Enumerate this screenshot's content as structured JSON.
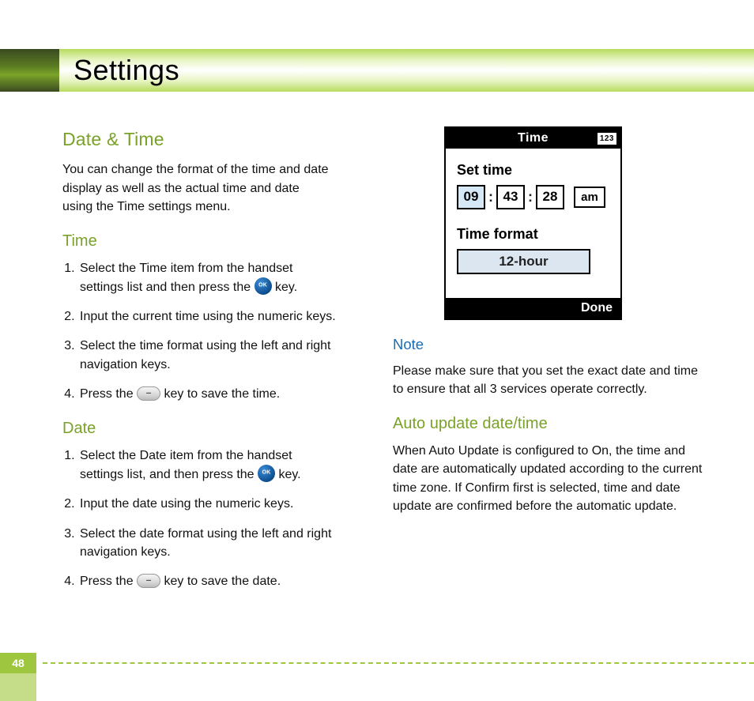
{
  "header": {
    "title": "Settings"
  },
  "left": {
    "heading": "Date & Time",
    "intro_l1": "You can change the format of the time and date",
    "intro_l2": "display as well as the actual time and date",
    "intro_l3": "using the Time settings menu.",
    "time_heading": "Time",
    "time_steps": {
      "s1a": "Select the Time item from the handset",
      "s1b": "settings list and then press the ",
      "s1c": " key.",
      "s2": "Input the current time using the numeric keys.",
      "s3a": "Select the time format using the left and right",
      "s3b": "navigation keys.",
      "s4a": "Press the ",
      "s4b": " key to save the time."
    },
    "date_heading": "Date",
    "date_steps": {
      "s1a": "Select the Date item from the handset",
      "s1b": "settings list, and then press the ",
      "s1c": " key.",
      "s2": "Input the date using the numeric keys.",
      "s3a": "Select the date format using the left and right",
      "s3b": "navigation keys.",
      "s4a": "Press the ",
      "s4b": " key to save the date."
    }
  },
  "right": {
    "note_heading": "Note",
    "note_body": "Please make sure that you set the exact date and time to ensure that all 3 services operate correctly.",
    "auto_heading": "Auto update date/time",
    "auto_body": "When Auto Update is configured to On, the time and date are automatically updated according to the current time zone. If Confirm first is selected, time and date update are confirmed before the automatic update."
  },
  "phone": {
    "title": "Time",
    "badge": "123",
    "set_label": "Set time",
    "hh": "09",
    "mm": "43",
    "ss": "28",
    "ampm": "am",
    "fmt_label": "Time format",
    "fmt_value": "12-hour",
    "done": "Done"
  },
  "footer": {
    "page": "48"
  }
}
